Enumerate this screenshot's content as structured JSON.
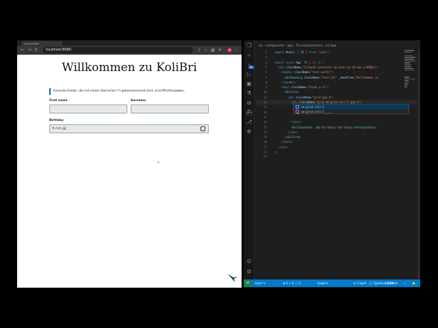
{
  "browser": {
    "tab_label": "localhost:8080",
    "url": "localhost:8080",
    "nav": [
      "←",
      "→",
      "↻"
    ],
    "toolbar_icons": [
      "share-icon",
      "star-icon",
      "extension-icon",
      "puzzle-icon",
      "sidebar-icon"
    ],
    "avatar_initial": "M"
  },
  "page": {
    "title": "Willkommen zu KoliBri",
    "hint": "Formular-Felder, die mit einem Sternchen (*) gekennzeichnet sind, sind Pflichtangaben.",
    "first_name_label": "First name",
    "surname_label": "Surname",
    "birthday_label": "Birthday",
    "birthday_placeholder": "tt.mm.jjjj",
    "cursor_glyph": "⌖"
  },
  "editor": {
    "breadcrumb": "src › components › app › TS component.tsx › [⌀] App",
    "lines": [
      {
        "n": "2",
        "html": "<span class='k'>import</span> <span class='a'>React</span>, { <span class='a'>FC</span> } <span class='k'>from</span> <span class='s'>'react'</span>;"
      },
      {
        "n": "3",
        "html": ""
      },
      {
        "n": "4",
        "html": "<span class='k'>export const</span> <span class='a'>App</span>: <span class='t'>FC</span> = () <span class='k'>=></span> ("
      },
      {
        "n": "5",
        "html": "  <span class='p'>&lt;</span><span class='k'>div</span> <span class='a'>className</span>=<span class='s'>\"stiband container mx-auto my-10 max-w-800px\"</span><span class='p'>&gt;</span>"
      },
      {
        "n": "6",
        "html": "    <span class='p'>&lt;</span><span class='k'>header</span> <span class='a'>className</span>=<span class='s'>\"text-center\"</span><span class='p'>&gt;</span>"
      },
      {
        "n": "7",
        "html": "      <span class='p'>&lt;</span><span class='t'>KolHeading</span> <span class='a'>className</span>=<span class='s'>\"text-2xl\"</span> <span class='a'>_headline</span>=<span class='s'>\"Willkommen zu</span>"
      },
      {
        "n": "8",
        "html": "    <span class='p'>&lt;/</span><span class='k'>header</span><span class='p'>&gt;</span>"
      },
      {
        "n": "9",
        "html": "    <span class='p'>&lt;</span><span class='k'>main</span> <span class='a'>className</span>=<span class='s'>\"block p-12\"</span><span class='p'>&gt;</span>"
      },
      {
        "n": "10",
        "html": "      <span class='p'>&lt;</span><span class='t'>KolForm</span><span class='p'>&gt;</span>"
      },
      {
        "n": "11",
        "html": "        <span class='p'>&lt;</span><span class='k'>div</span> <span class='a'>className</span>=<span class='s'>\"grid gap-4\"</span><span class='p'>&gt;</span>"
      },
      {
        "n": "12",
        "html": "          <span class='p'>&lt;</span><span class='k'>div</span> <span class='a'>className</span>=<span class='s'>\"grid md:grid-cols-2 gap-4\"</span><span class='p'>&gt;</span>"
      },
      {
        "n": "13",
        "html": ""
      },
      {
        "n": "14",
        "html": ""
      },
      {
        "n": "15",
        "html": ""
      },
      {
        "n": "16",
        "html": "          <span class='p'>&lt;/</span><span class='k'>div</span><span class='p'>&gt;</span>"
      },
      {
        "n": "17",
        "html": "          <span class='p'>&lt;</span><span class='t'>KolInputDate</span> <span class='a'>_id</span>=<span class='s'>\"birthday\"</span><span class='p'>&gt;</span>Birthday<span class='p'>&lt;/</span><span class='t'>KolInputDate</span><span class='p'>&gt;</span>"
      },
      {
        "n": "18",
        "html": "        <span class='p'>&lt;/</span><span class='k'>div</span><span class='p'>&gt;</span>"
      },
      {
        "n": "19",
        "html": "      <span class='p'>&lt;/</span><span class='t'>KolForm</span><span class='p'>&gt;</span>"
      },
      {
        "n": "20",
        "html": "    <span class='p'>&lt;/</span><span class='k'>main</span><span class='p'>&gt;</span>"
      },
      {
        "n": "21",
        "html": "  <span class='p'>&lt;/</span><span class='k'>div</span><span class='p'>&gt;</span>"
      },
      {
        "n": "22",
        "html": ");"
      },
      {
        "n": "23",
        "html": ""
      }
    ],
    "suggestions": [
      "sm:grid-cols-2",
      "sm:grid-cols-2 ___"
    ],
    "status": {
      "branch": "main*+",
      "problems": "⊗ 0 ⚠ 0 ⓘ 2",
      "language": "English",
      "spaces": "⚖ 2 Spell",
      "tsx": "{} TypeScript JSX",
      "prettier": "✓ Prettier"
    }
  }
}
